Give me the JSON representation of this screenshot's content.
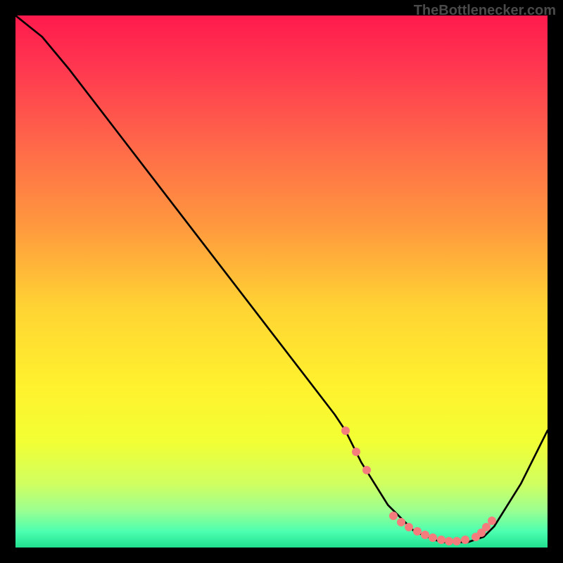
{
  "attribution": "TheBottlenecker.com",
  "chart_data": {
    "type": "line",
    "title": "",
    "xlabel": "",
    "ylabel": "",
    "xlim": [
      0,
      100
    ],
    "ylim": [
      0,
      100
    ],
    "series": [
      {
        "name": "curve",
        "x": [
          0,
          5,
          10,
          15,
          20,
          25,
          30,
          35,
          40,
          45,
          50,
          55,
          60,
          62,
          65,
          70,
          75,
          80,
          85,
          88,
          90,
          95,
          100
        ],
        "y": [
          100,
          96,
          90,
          83.5,
          77,
          70.5,
          64,
          57.5,
          51,
          44.5,
          38,
          31.5,
          25,
          22,
          16,
          8,
          3,
          1,
          1,
          2,
          4,
          12,
          22
        ]
      }
    ],
    "markers": {
      "name": "dots",
      "x": [
        62,
        64,
        66,
        71,
        72.5,
        74,
        75.5,
        77,
        78.5,
        80,
        81.5,
        83,
        84.5,
        86.5,
        87.5,
        88.5,
        89.5
      ],
      "y": [
        22,
        18,
        14.5,
        6,
        4.8,
        3.8,
        3,
        2.4,
        1.8,
        1.4,
        1.2,
        1.2,
        1.4,
        2,
        2.8,
        3.8,
        5
      ]
    },
    "background_gradient_stops": [
      {
        "pos": 0.0,
        "color": "#ff1a4d"
      },
      {
        "pos": 0.1,
        "color": "#ff3850"
      },
      {
        "pos": 0.25,
        "color": "#ff6a49"
      },
      {
        "pos": 0.4,
        "color": "#ff9a3e"
      },
      {
        "pos": 0.55,
        "color": "#ffd433"
      },
      {
        "pos": 0.7,
        "color": "#fff22e"
      },
      {
        "pos": 0.8,
        "color": "#f2ff33"
      },
      {
        "pos": 0.88,
        "color": "#d0ff60"
      },
      {
        "pos": 0.93,
        "color": "#9cff90"
      },
      {
        "pos": 0.97,
        "color": "#4cffb0"
      },
      {
        "pos": 1.0,
        "color": "#20e090"
      }
    ]
  }
}
